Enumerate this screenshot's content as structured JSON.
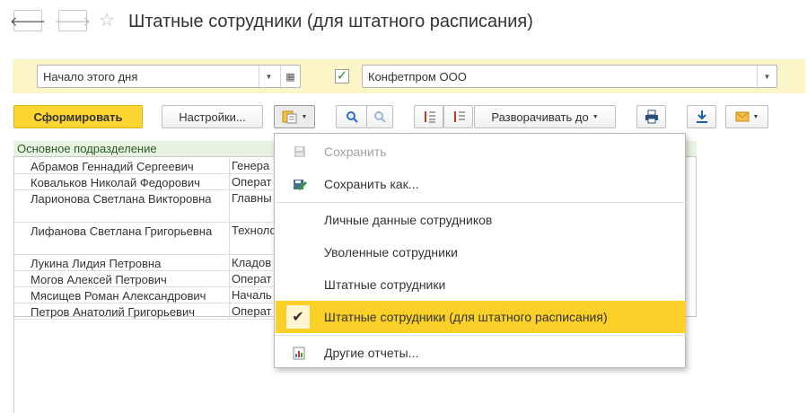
{
  "window": {
    "title": "Штатные сотрудники (для штатного расписания)"
  },
  "params": {
    "period": "Начало этого дня",
    "organization_checked": true,
    "organization": "Конфетпром ООО"
  },
  "toolbar": {
    "generate_label": "Сформировать",
    "settings_label": "Настройки...",
    "expand_label": "Разворачивать до"
  },
  "table": {
    "group_header": "Основное подразделение",
    "rows": [
      {
        "name": "Абрамов Геннадий Сергеевич",
        "position": "Генера"
      },
      {
        "name": "Ковальков Николай Федорович",
        "position": "Операт"
      },
      {
        "name": "Ларионова Светлана Викторовна",
        "position": "Главны"
      },
      {
        "name": "Лифанова Светлана Григорьевна",
        "position": "Техноло"
      },
      {
        "name": "Лукина Лидия Петровна",
        "position": "Кладов"
      },
      {
        "name": "Могов Алексей Петрович",
        "position": "Операт"
      },
      {
        "name": "Мясищев Роман Александрович",
        "position": "Началь"
      },
      {
        "name": "Петров Анатолий Григорьевич",
        "position": "Операт"
      }
    ]
  },
  "menu": {
    "save": "Сохранить",
    "save_as": "Сохранить как...",
    "items": [
      "Личные данные сотрудников",
      "Уволенные сотрудники",
      "Штатные сотрудники",
      "Штатные сотрудники (для штатного расписания)"
    ],
    "other_reports": "Другие отчеты..."
  }
}
